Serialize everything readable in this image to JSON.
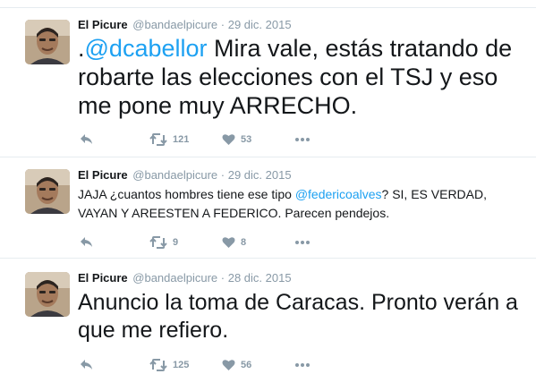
{
  "tweets": [
    {
      "fullname": "El Picure",
      "username": "@bandaelpicure",
      "separator": "·",
      "timestamp": "29 dic. 2015",
      "text_prefix": ".",
      "mention": "@dcabellor",
      "text_suffix": " Mira vale, estás tratando de robarte las elecciones con el TSJ y eso me pone muy ARRECHO.",
      "retweets": "121",
      "likes": "53"
    },
    {
      "fullname": "El Picure",
      "username": "@bandaelpicure",
      "separator": "·",
      "timestamp": "29 dic. 2015",
      "text_prefix": "JAJA ¿cuantos hombres tiene ese tipo ",
      "mention": "@federicoalves",
      "text_suffix": "? SI, ES VERDAD, VAYAN Y AREESTEN A FEDERICO. Parecen pendejos.",
      "retweets": "9",
      "likes": "8"
    },
    {
      "fullname": "El Picure",
      "username": "@bandaelpicure",
      "separator": "·",
      "timestamp": "28 dic. 2015",
      "text": "Anuncio la toma de Caracas. Pronto verán a que me refiero.",
      "retweets": "125",
      "likes": "56"
    }
  ],
  "icons": {
    "reply": "reply-icon",
    "retweet": "retweet-icon",
    "like": "heart-icon",
    "more": "more-dots-icon"
  },
  "colors": {
    "mention": "#1da1f2",
    "muted": "#8899a6",
    "text": "#14171a",
    "divider": "#e6ecf0"
  }
}
